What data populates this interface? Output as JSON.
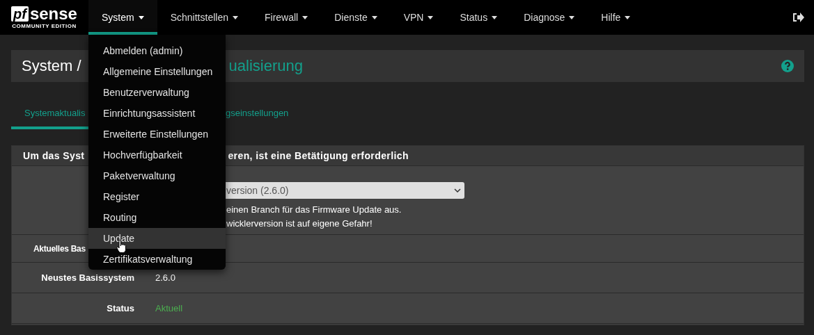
{
  "navbar": {
    "logo": {
      "mark": "pf",
      "word": "sense",
      "edition": "COMMUNITY EDITION"
    },
    "menus": [
      {
        "label": "System",
        "selected": true
      },
      {
        "label": "Schnittstellen",
        "selected": false
      },
      {
        "label": "Firewall",
        "selected": false
      },
      {
        "label": "Dienste",
        "selected": false
      },
      {
        "label": "VPN",
        "selected": false
      },
      {
        "label": "Status",
        "selected": false
      },
      {
        "label": "Diagnose",
        "selected": false
      },
      {
        "label": "Hilfe",
        "selected": false
      }
    ]
  },
  "dropdown": {
    "items": [
      {
        "label": "Abmelden (admin)",
        "selected": false
      },
      {
        "label": "Allgemeine Einstellungen",
        "selected": false
      },
      {
        "label": "Benutzerverwaltung",
        "selected": false
      },
      {
        "label": "Einrichtungsassistent",
        "selected": false
      },
      {
        "label": "Erweiterte Einstellungen",
        "selected": false
      },
      {
        "label": "Hochverfügbarkeit",
        "selected": false
      },
      {
        "label": "Paketverwaltung",
        "selected": false
      },
      {
        "label": "Register",
        "selected": false
      },
      {
        "label": "Routing",
        "selected": false
      },
      {
        "label": "Update",
        "selected": true
      },
      {
        "label": "Zertifikatsverwaltung",
        "selected": false
      }
    ]
  },
  "breadcrumb": {
    "root": "System /",
    "current": "ualisierung"
  },
  "tabs": [
    {
      "label": "Systemaktualis",
      "selected": true
    },
    {
      "label": "gseinstellungen",
      "selected": false
    }
  ],
  "panel": {
    "heading_left": "Um das Syst",
    "heading_right": "eren, ist eine Betätigung erforderlich",
    "branch_select": {
      "value": "version (2.6.0)"
    },
    "help_lines": [
      "einen Branch für das Firmware Update aus.",
      "wicklerversion ist auf eigene Gefahr!"
    ],
    "rows": [
      {
        "kind": "covered",
        "label": "Aktuelles Bas"
      },
      {
        "kind": "text",
        "label": "Neustes Basissystem",
        "value": "2.6.0"
      },
      {
        "kind": "status",
        "label": "Status",
        "value": "Aktuell"
      }
    ]
  }
}
